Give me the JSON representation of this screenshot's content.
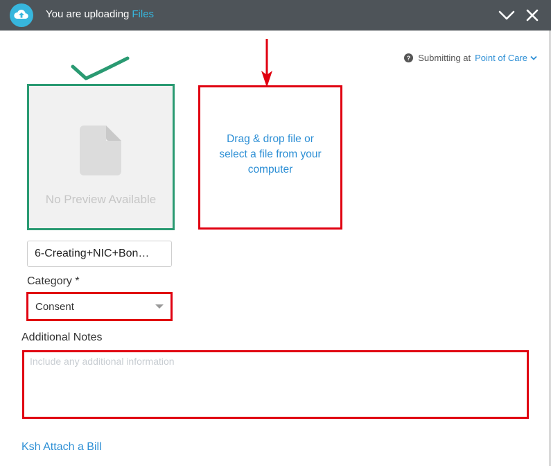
{
  "header": {
    "title_prefix": "You are uploading",
    "title_accent": "Files",
    "icons": [
      "cloud-upload-icon",
      "chevron-down-icon",
      "close-icon"
    ]
  },
  "submitting": {
    "label": "Submitting at",
    "location": "Point of Care",
    "icons": [
      "question-icon",
      "chevron-down-icon"
    ]
  },
  "preview": {
    "text": "No Preview Available",
    "icon": "file-icon"
  },
  "dropzone": {
    "text": "Drag & drop file or select a file from your computer"
  },
  "file": {
    "name": "6-Creating+NIC+Bon…"
  },
  "category": {
    "label": "Category *",
    "value": "Consent"
  },
  "notes": {
    "label": "Additional Notes",
    "placeholder": "Include any additional information"
  },
  "attach_bill": {
    "label": "Ksh Attach a Bill"
  },
  "colors": {
    "header_bg": "#4e5459",
    "accent": "#37b6dd",
    "link": "#2d8fd5",
    "highlight_red": "#e00010",
    "highlight_green": "#2a9a72"
  }
}
